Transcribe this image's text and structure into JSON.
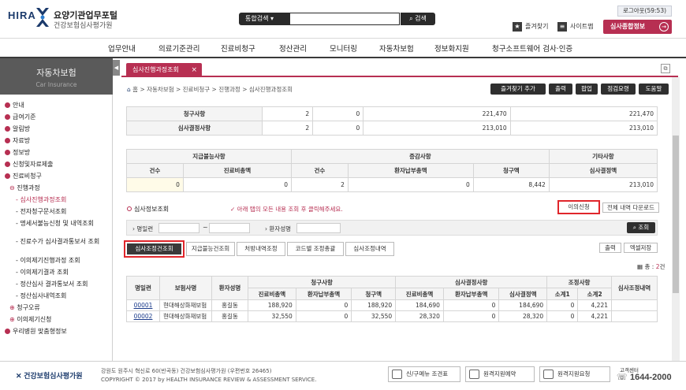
{
  "header": {
    "brand": "HIRA",
    "title": "요양기관업무포털",
    "subtitle": "건강보험심사평가원",
    "search_scope": "통합검색",
    "search_value": "",
    "search_button": "검색",
    "logout": "로그아웃(59:53)",
    "favorites": "즐겨찾기",
    "sitemap": "사이트맵",
    "review_info": "심사종합정보"
  },
  "nav": [
    "업무안내",
    "의료기준관리",
    "진료비청구",
    "정산관리",
    "모니터링",
    "자동차보험",
    "정보화지원",
    "청구소프트웨어 검사·인증"
  ],
  "sidebar": {
    "title": "자동차보험",
    "subtitle": "Car Insurance",
    "items": [
      {
        "label": "안내",
        "level": 1
      },
      {
        "label": "급여기준",
        "level": 1
      },
      {
        "label": "알림방",
        "level": 1
      },
      {
        "label": "자료방",
        "level": 1
      },
      {
        "label": "정보방",
        "level": 1
      },
      {
        "label": "신청및자료제출",
        "level": 1
      },
      {
        "label": "진료비청구",
        "level": 1
      },
      {
        "label": "진행과정",
        "level": 2
      },
      {
        "label": "심사진행과정조회",
        "level": 3,
        "active": true
      },
      {
        "label": "전자청구문서조회",
        "level": 3
      },
      {
        "label": "명세서불능신청 및 내역조회",
        "level": 3
      },
      {
        "label": "진료수가 심사결과통보서 조회",
        "level": 3
      },
      {
        "label": "이의제기진행과정 조회",
        "level": 3
      },
      {
        "label": "이의제기결과 조회",
        "level": 3
      },
      {
        "label": "정산심사 결과통보서 조회",
        "level": 3
      },
      {
        "label": "정산심사내역조회",
        "level": 3
      },
      {
        "label": "청구오류",
        "level": 2
      },
      {
        "label": "이의제기신청",
        "level": 2
      },
      {
        "label": "우리병원 맞춤형정보",
        "level": 1
      }
    ]
  },
  "tabs": [
    {
      "label": "심사진행과정조회",
      "close": "×"
    }
  ],
  "breadcrumb": "홈 > 자동차보험 > 진료비청구 > 진행과정 > 심사진행과정조회",
  "toolbar": [
    "즐겨찾기 추가",
    "출력",
    "팝업",
    "점검요령",
    "도움말"
  ],
  "summary1": {
    "rows": [
      {
        "label": "청구사항",
        "v1": "2",
        "v2": "0",
        "v3": "221,470",
        "v4": "221,470"
      },
      {
        "label": "심사결정사항",
        "v1": "2",
        "v2": "0",
        "v3": "213,010",
        "v4": "213,010"
      }
    ]
  },
  "summary2": {
    "groups": [
      "지급불능사항",
      "증감사항",
      "기타사항"
    ],
    "cols": [
      "건수",
      "진료비총액",
      "건수",
      "환자납부총액",
      "청구액",
      "심사결정액"
    ],
    "row": [
      "0",
      "0",
      "2",
      "0",
      "8,442",
      "213,010"
    ]
  },
  "review": {
    "title": "심사정보조회",
    "note": "✓ 아래 탭의 모든 내용 조회 후 클릭해주세요.",
    "objection_button": "이의신청",
    "download_button": "전체 내역 다운로드",
    "filter_date_label": "명일련",
    "filter_date_sep": "~",
    "filter_patient_label": "환자성명",
    "query_button": "조회"
  },
  "subtabs": [
    "심사조정건조회",
    "지급불능건조회",
    "처방내역조정",
    "코드별 조정총괄",
    "심사조정내역"
  ],
  "list_actions": {
    "print": "출력",
    "excel": "엑셀저장"
  },
  "count_label": "총 : ",
  "count_value": "2",
  "count_unit": "건",
  "result": {
    "head_top": [
      "명일련",
      "보험사명",
      "환자성명",
      "청구사항",
      "심사결정사항",
      "조정사항",
      "심사조정내역"
    ],
    "head_sub": [
      "진료비총액",
      "환자납부총액",
      "청구액",
      "진료비총액",
      "환자납부총액",
      "심사결정액",
      "소계1",
      "소계2"
    ],
    "rows": [
      {
        "no": "00001",
        "ins": "현대해상화재보험",
        "pt": "홍길동",
        "c1": "188,920",
        "c2": "0",
        "c3": "188,920",
        "d1": "184,690",
        "d2": "0",
        "d3": "184,690",
        "s1": "0",
        "s2": "4,221"
      },
      {
        "no": "00002",
        "ins": "현대해상화재보험",
        "pt": "홍길동",
        "c1": "32,550",
        "c2": "0",
        "c3": "32,550",
        "d1": "28,320",
        "d2": "0",
        "d3": "28,320",
        "s1": "0",
        "s2": "4,221"
      }
    ]
  },
  "footer": {
    "logo": "건강보험심사평가원",
    "address": "강원도 원주시 혁신로 60(반곡동) 건강보험심사평가원 (우편번호 26465)",
    "copyright": "COPYRIGHT © 2017 by HEALTH INSURANCE REVIEW & ASSESSMENT SERVICE.",
    "btn1": "신/구메뉴 조견표",
    "btn2": "원격지원예약",
    "btn3": "원격지원요청",
    "cc_label": "고객센터",
    "phone": "1644-2000"
  }
}
